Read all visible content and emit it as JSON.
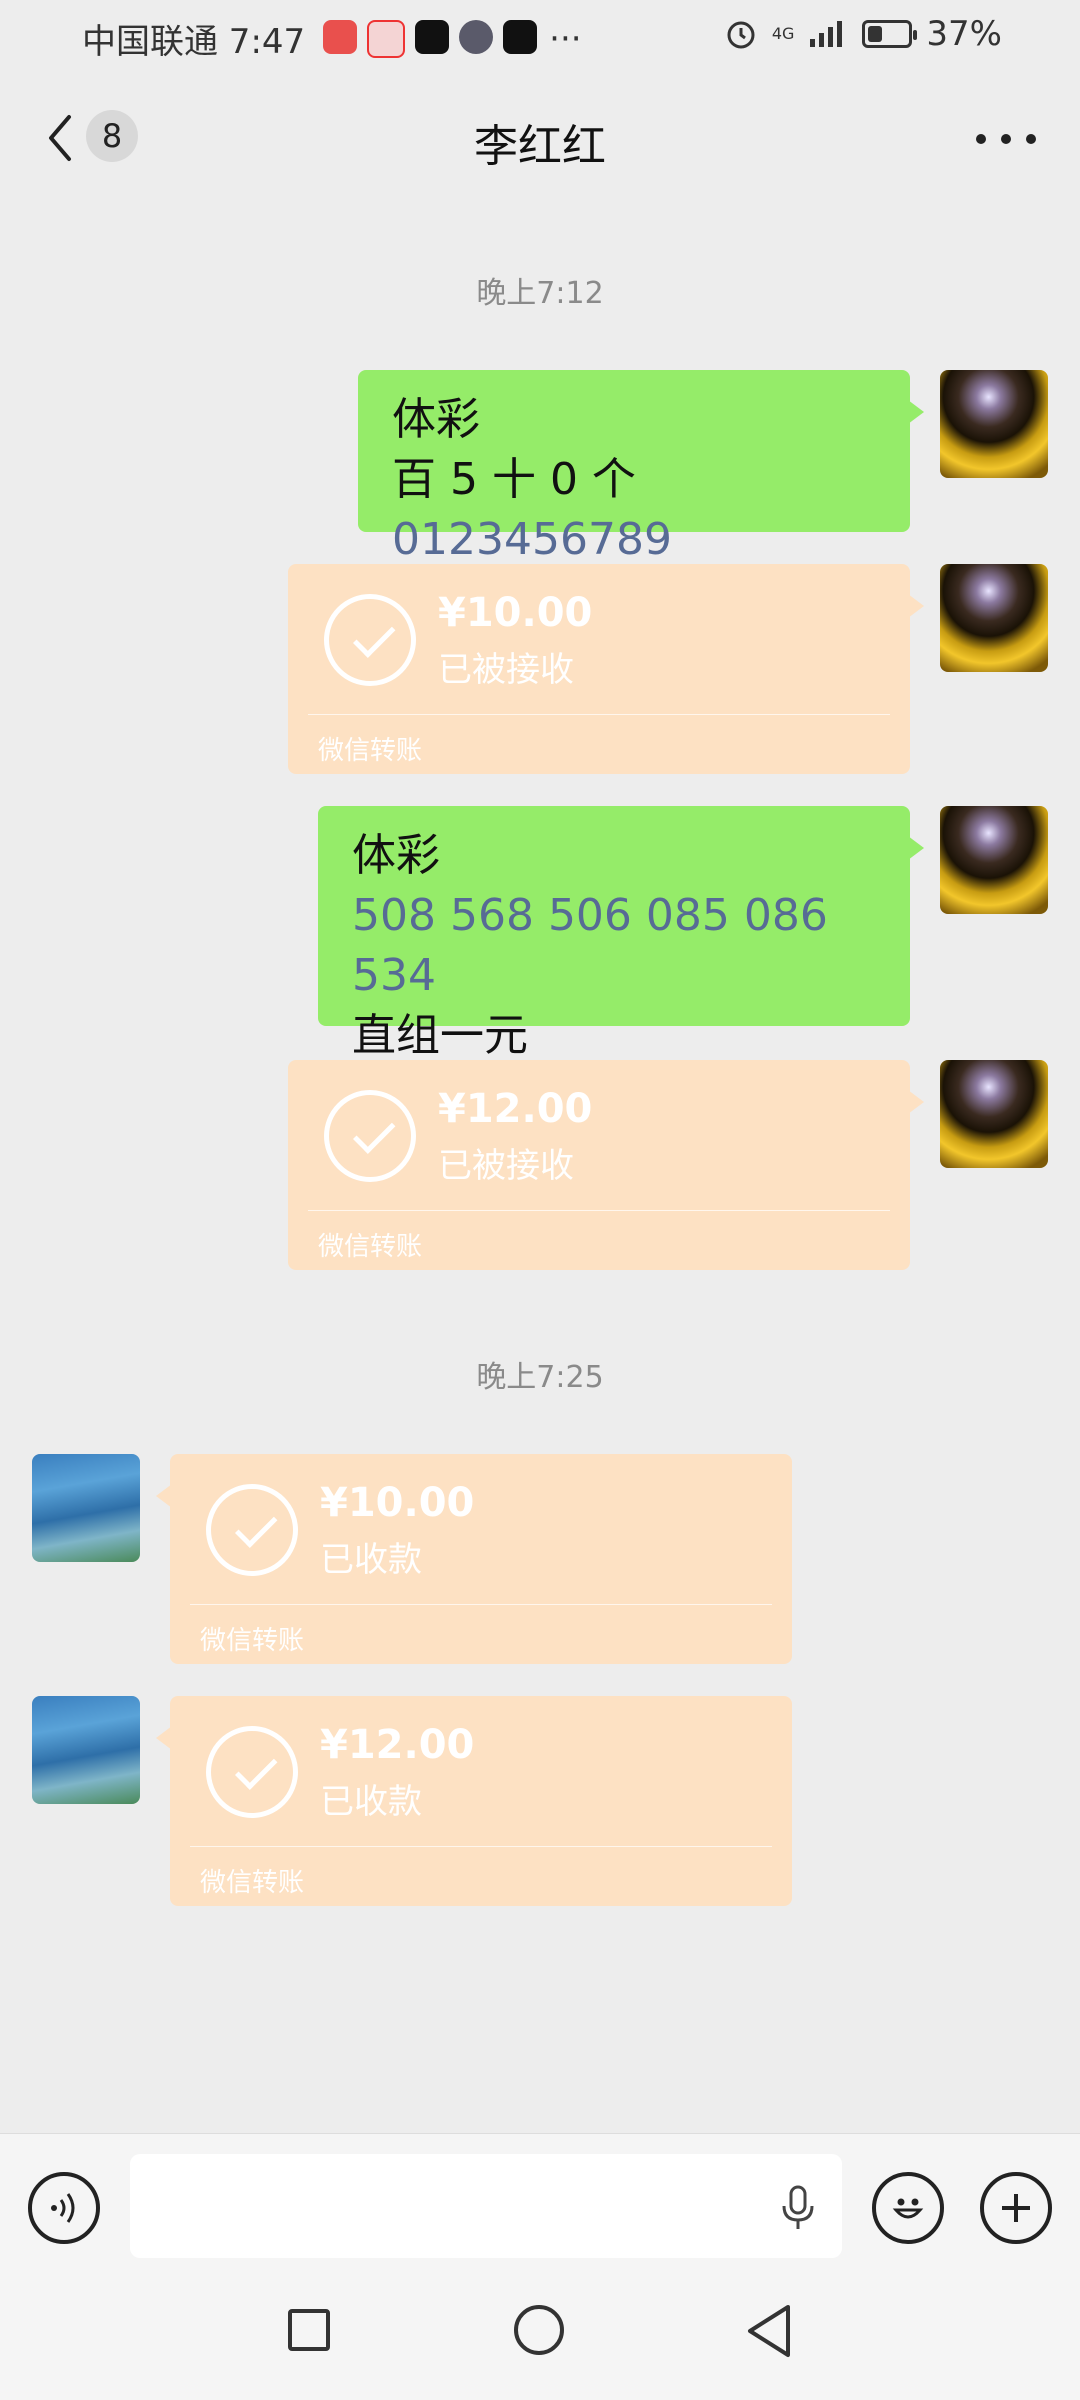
{
  "status_bar": {
    "carrier_time": "中国联通 7:47",
    "more": "···",
    "network": "4G",
    "battery": "37%",
    "battery_level": 0.37
  },
  "header": {
    "unread_count": "8",
    "title": "李红红"
  },
  "messages": {
    "time1": "晚上7:12",
    "msg1": {
      "line1": "体彩",
      "line2_prefix": "百 5 十 0 个 ",
      "line2_link": "0123456789"
    },
    "transfer1": {
      "amount": "¥10.00",
      "status": "已被接收",
      "source": "微信转账"
    },
    "msg2": {
      "line1": "体彩",
      "line2_link": "508 568 506 085 086 534",
      "line3": "直组一元"
    },
    "transfer2": {
      "amount": "¥12.00",
      "status": "已被接收",
      "source": "微信转账"
    },
    "time2": "晚上7:25",
    "transfer3": {
      "amount": "¥10.00",
      "status": "已收款",
      "source": "微信转账"
    },
    "transfer4": {
      "amount": "¥12.00",
      "status": "已收款",
      "source": "微信转账"
    }
  },
  "input_bar": {
    "text_value": ""
  }
}
